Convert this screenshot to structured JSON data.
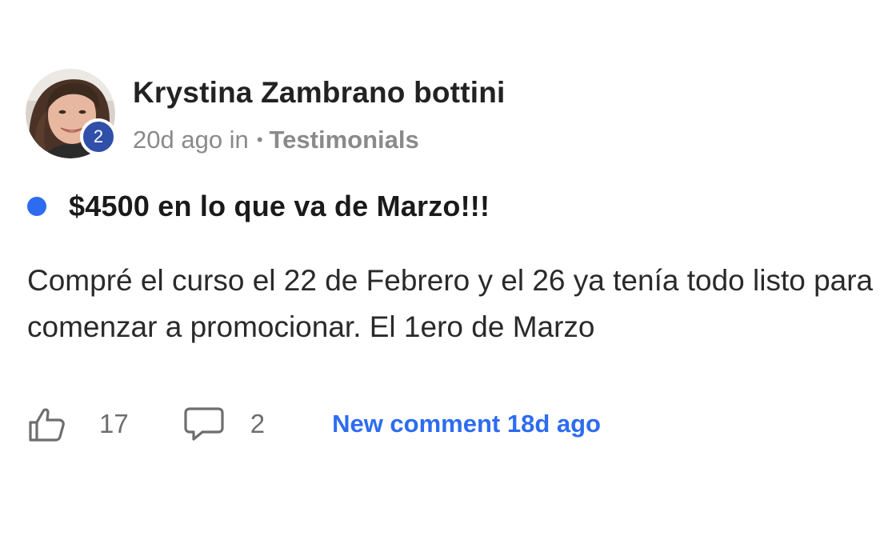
{
  "post": {
    "author": {
      "name": "Krystina Zambrano bottini",
      "level": "2"
    },
    "meta": {
      "time": "20d ago in",
      "separator": "•",
      "category": "Testimonials"
    },
    "title": "$4500 en lo que va de Marzo!!!",
    "body": "Compré el curso el 22 de Febrero y el 26 ya tenía todo listo para comenzar a promocionar. El 1ero de Marzo",
    "footer": {
      "likes": "17",
      "comments": "2",
      "new_comment": "New comment 18d ago"
    }
  },
  "colors": {
    "accent": "#2d6cf1",
    "badge": "#2f4fa8",
    "muted": "#8a8a8a",
    "text": "#1f1f1f"
  },
  "icons": {
    "like": "thumbs-up-icon",
    "comment": "comment-bubble-icon",
    "unread": "unread-dot-icon"
  }
}
